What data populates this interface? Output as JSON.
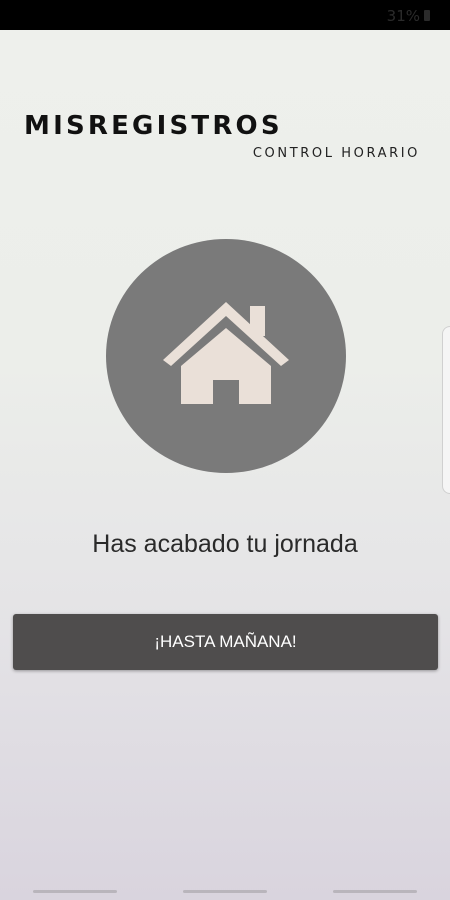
{
  "status_bar": {
    "battery_text": "31%",
    "battery_icon": "battery-icon"
  },
  "brand": {
    "title": "MISREGISTROS",
    "subtitle": "CONTROL HORARIO"
  },
  "status_icon": {
    "icon": "home-icon",
    "circle_color": "#7a7a7a",
    "icon_color": "#eae0d8"
  },
  "message": "Has acabado tu jornada",
  "action_button": {
    "label": "¡HASTA MAÑANA!",
    "color": "#4f4d4d"
  },
  "navigation": {
    "items": [
      "recent-apps-bar",
      "home-bar",
      "back-bar"
    ]
  }
}
